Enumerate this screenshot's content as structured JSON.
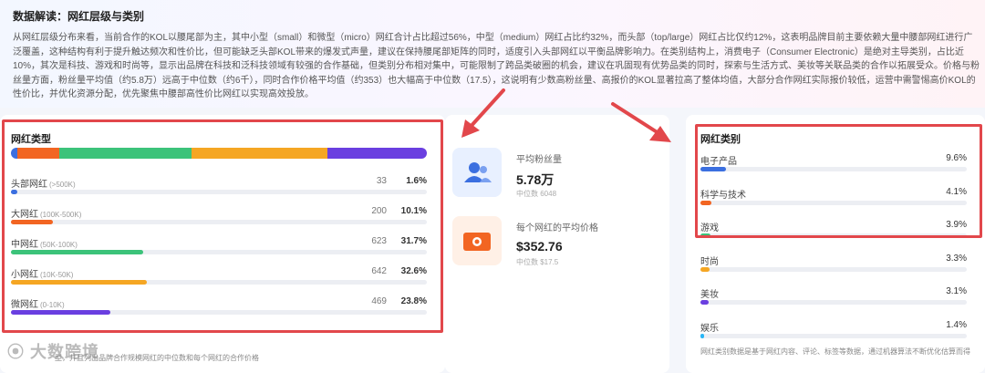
{
  "banner": {
    "title": "数据解读：网红层级与类别",
    "text": "从网红层级分布来看，当前合作的KOL以腰尾部为主，其中小型（small）和微型（micro）网红合计占比超过56%，中型（medium）网红占比约32%，而头部（top/large）网红占比仅约12%，这表明品牌目前主要依赖大量中腰部网红进行广泛覆盖，这种结构有利于提升触达频次和性价比，但可能缺乏头部KOL带来的爆发式声量，建议在保持腰尾部矩阵的同时，适度引入头部网红以平衡品牌影响力。在类别结构上，消费电子（Consumer Electronic）是绝对主导类别，占比近10%，其次是科技、游戏和时尚等，显示出品牌在科技和泛科技领域有较强的合作基础，但类别分布相对集中，可能限制了跨品类破圈的机会，建议在巩固现有优势品类的同时，探索与生活方式、美妆等关联品类的合作以拓展受众。价格与粉丝量方面，粉丝量平均值（约5.8万）远高于中位数（约6千），同时合作价格平均值（约353）也大幅高于中位数（17.5），这说明有少数高粉丝量、高报价的KOL显著拉高了整体均值，大部分合作网红实际报价较低，运营中需警惕高价KOL的性价比，并优化资源分配，优先聚焦中腰部高性价比网红以实现高效投放。"
  },
  "tiers": {
    "title": "网红类型",
    "items": [
      {
        "label": "头部网红",
        "range": "(>500K)",
        "count": "33",
        "pct": "1.6%",
        "share": 1.6,
        "color": "#3b6fe0"
      },
      {
        "label": "大网红",
        "range": "(100K-500K)",
        "count": "200",
        "pct": "10.1%",
        "share": 10.1,
        "color": "#f26522"
      },
      {
        "label": "中网红",
        "range": "(50K-100K)",
        "count": "623",
        "pct": "31.7%",
        "share": 31.7,
        "color": "#3cc37a"
      },
      {
        "label": "小网红",
        "range": "(10K-50K)",
        "count": "642",
        "pct": "32.6%",
        "share": 32.6,
        "color": "#f5a623"
      },
      {
        "label": "微网红",
        "range": "(0-10K)",
        "count": "469",
        "pct": "23.8%",
        "share": 23.8,
        "color": "#6a3fe0"
      }
    ],
    "footnote": "型，并且列出品牌合作规模网红的中位数和每个网红的合作价格"
  },
  "watermark": "大数跨境",
  "stats": [
    {
      "label": "平均粉丝量",
      "value": "5.78万",
      "sub": "中位数 6048",
      "icon": "users-icon",
      "bg": "#e8f0ff",
      "color": "#3b6fe0"
    },
    {
      "label": "每个网红的平均价格",
      "value": "$352.76",
      "sub": "中位数 $17.5",
      "icon": "wallet-icon",
      "bg": "#fff0e6",
      "color": "#f26522"
    }
  ],
  "categories": {
    "title": "网红类别",
    "items": [
      {
        "label": "电子产品",
        "pct": "9.6%",
        "share": 9.6,
        "color": "#3b6fe0"
      },
      {
        "label": "科学与技术",
        "pct": "4.1%",
        "share": 4.1,
        "color": "#f26522"
      },
      {
        "label": "游戏",
        "pct": "3.9%",
        "share": 3.9,
        "color": "#3cc37a"
      },
      {
        "label": "时尚",
        "pct": "3.3%",
        "share": 3.3,
        "color": "#f5a623"
      },
      {
        "label": "美妆",
        "pct": "3.1%",
        "share": 3.1,
        "color": "#6a3fe0"
      },
      {
        "label": "娱乐",
        "pct": "1.4%",
        "share": 1.4,
        "color": "#29b6f6"
      }
    ],
    "footnote": "网红类别数据是基于网红内容、评论、标签等数据，通过机器算法不断优化估算而得"
  }
}
